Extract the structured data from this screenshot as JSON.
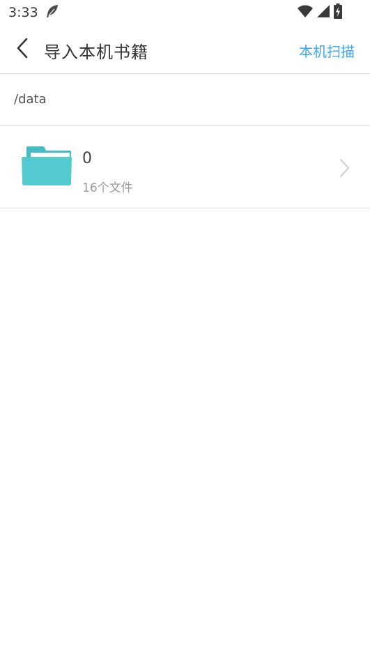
{
  "status_bar": {
    "time": "3:33",
    "icons": [
      "feather-icon",
      "wifi-icon",
      "signal-icon",
      "battery-charging-icon"
    ]
  },
  "app_bar": {
    "title": "导入本机书籍",
    "action_label": "本机扫描",
    "back_icon": "chevron-left-icon",
    "accent_color": "#3aa8f0"
  },
  "path": {
    "current": "/data"
  },
  "folders": [
    {
      "name": "0",
      "count_label": "16个文件",
      "icon": "folder-icon",
      "icon_color": "#4fc7cd"
    }
  ]
}
